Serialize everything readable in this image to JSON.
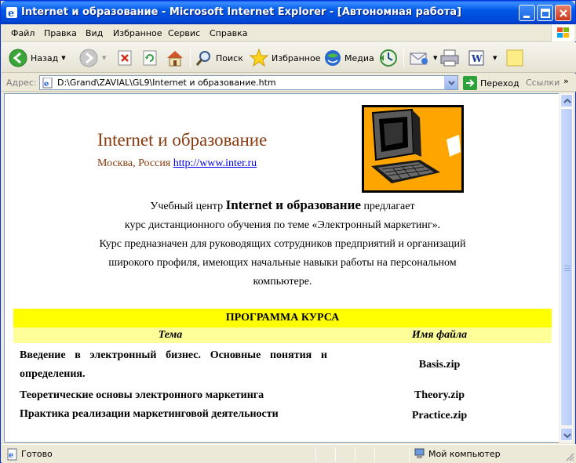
{
  "window": {
    "title": "Internet и образование - Microsoft Internet Explorer - [Автономная работа]"
  },
  "menu": [
    {
      "label": "Файл"
    },
    {
      "label": "Правка"
    },
    {
      "label": "Вид"
    },
    {
      "label": "Избранное"
    },
    {
      "label": "Сервис"
    },
    {
      "label": "Справка"
    }
  ],
  "toolbar": {
    "back": "Назад",
    "search": "Поиск",
    "favorites": "Избранное",
    "media": "Медиа"
  },
  "address": {
    "label": "Адрес:",
    "url": "D:\\Grand\\ZAVIAL\\GL9\\Internet и образование.htm",
    "go": "Переход",
    "links": "Ссылки"
  },
  "page": {
    "title": "Internet и образование",
    "location": "Москва, Россия",
    "link": "http://www.inter.ru",
    "intro_prefix": "Учебный центр ",
    "intro_bold": "Internet и образование",
    "intro_suffix": " предлагает",
    "intro_line2": "курс дистанционного обучения по теме «Электронный маркетинг».",
    "intro_line3": "Курс предназначен для руководящих сотрудников предприятий и организаций",
    "intro_line4": "широкого профиля, имеющих начальные навыки работы на персональном",
    "intro_line5": "компьютере."
  },
  "program": {
    "heading": "ПРОГРАММА КУРСА",
    "col_topic": "Тема",
    "col_file": "Имя файла",
    "rows": [
      {
        "topic": "Введение в электронный бизнес. Основные понятия и определения.",
        "file": "Basis.zip"
      },
      {
        "topic": "Теоретические основы электронного маркетинга",
        "file": "Theory.zip"
      },
      {
        "topic": "Практика реализации маркетинговой деятельности",
        "file": "Practice.zip"
      }
    ]
  },
  "status": {
    "text": "Готово",
    "zone": "Мой компьютер"
  }
}
